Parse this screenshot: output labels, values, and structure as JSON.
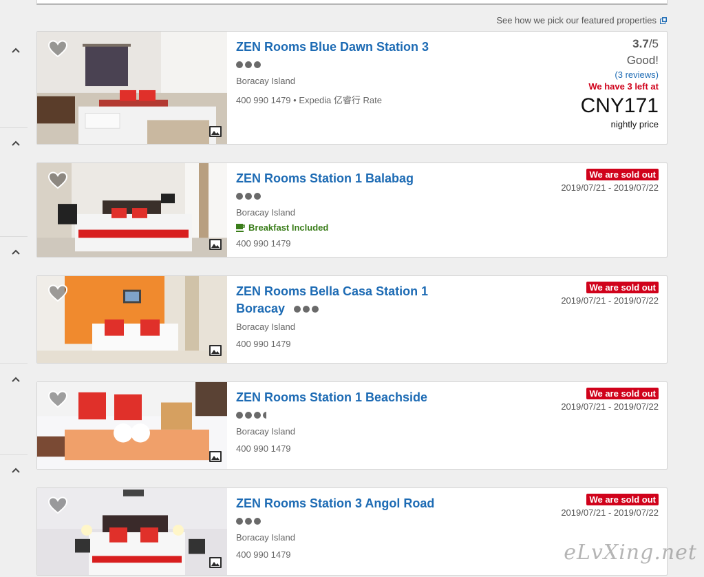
{
  "featured_link": "See how we pick our featured properties",
  "colors": {
    "link": "#1d6bb4",
    "sold_out_bg": "#d0021b",
    "breakfast": "#3a7d1a"
  },
  "hotels": [
    {
      "name": "ZEN Rooms Blue Dawn Station 3",
      "stars": 3,
      "location": "Boracay Island",
      "phone": "400 990 1479",
      "rate_note": "Expedia 亿睿行 Rate",
      "rating": "3.7",
      "rating_outof": "/5",
      "rating_word": "Good!",
      "reviews": "(3 reviews)",
      "left_at": "We have 3 left at",
      "price": "CNY171",
      "nightly": "nightly price"
    },
    {
      "name": "ZEN Rooms Station 1 Balabag",
      "stars": 3,
      "location": "Boracay Island",
      "breakfast": "Breakfast Included",
      "phone": "400 990 1479",
      "sold_out": "We are sold out",
      "dates": "2019/07/21 - 2019/07/22"
    },
    {
      "name_line1": "ZEN Rooms Bella Casa Station 1",
      "name_line2": "Boracay",
      "stars": 3,
      "location": "Boracay Island",
      "phone": "400 990 1479",
      "sold_out": "We are sold out",
      "dates": "2019/07/21 - 2019/07/22"
    },
    {
      "name": "ZEN Rooms Station 1 Beachside",
      "stars": 3.5,
      "location": "Boracay Island",
      "phone": "400 990 1479",
      "sold_out": "We are sold out",
      "dates": "2019/07/21 - 2019/07/22"
    },
    {
      "name": "ZEN Rooms Station 3 Angol Road",
      "stars": 3,
      "location": "Boracay Island",
      "phone": "400 990 1479",
      "sold_out": "We are sold out",
      "dates": "2019/07/21 - 2019/07/22"
    }
  ],
  "watermark": "eLvXing.net",
  "icons": {
    "favorite": "heart-icon",
    "gallery": "gallery-icon",
    "collapse": "chevron-up-icon",
    "breakfast": "coffee-cup-icon",
    "external": "external-link-icon"
  }
}
